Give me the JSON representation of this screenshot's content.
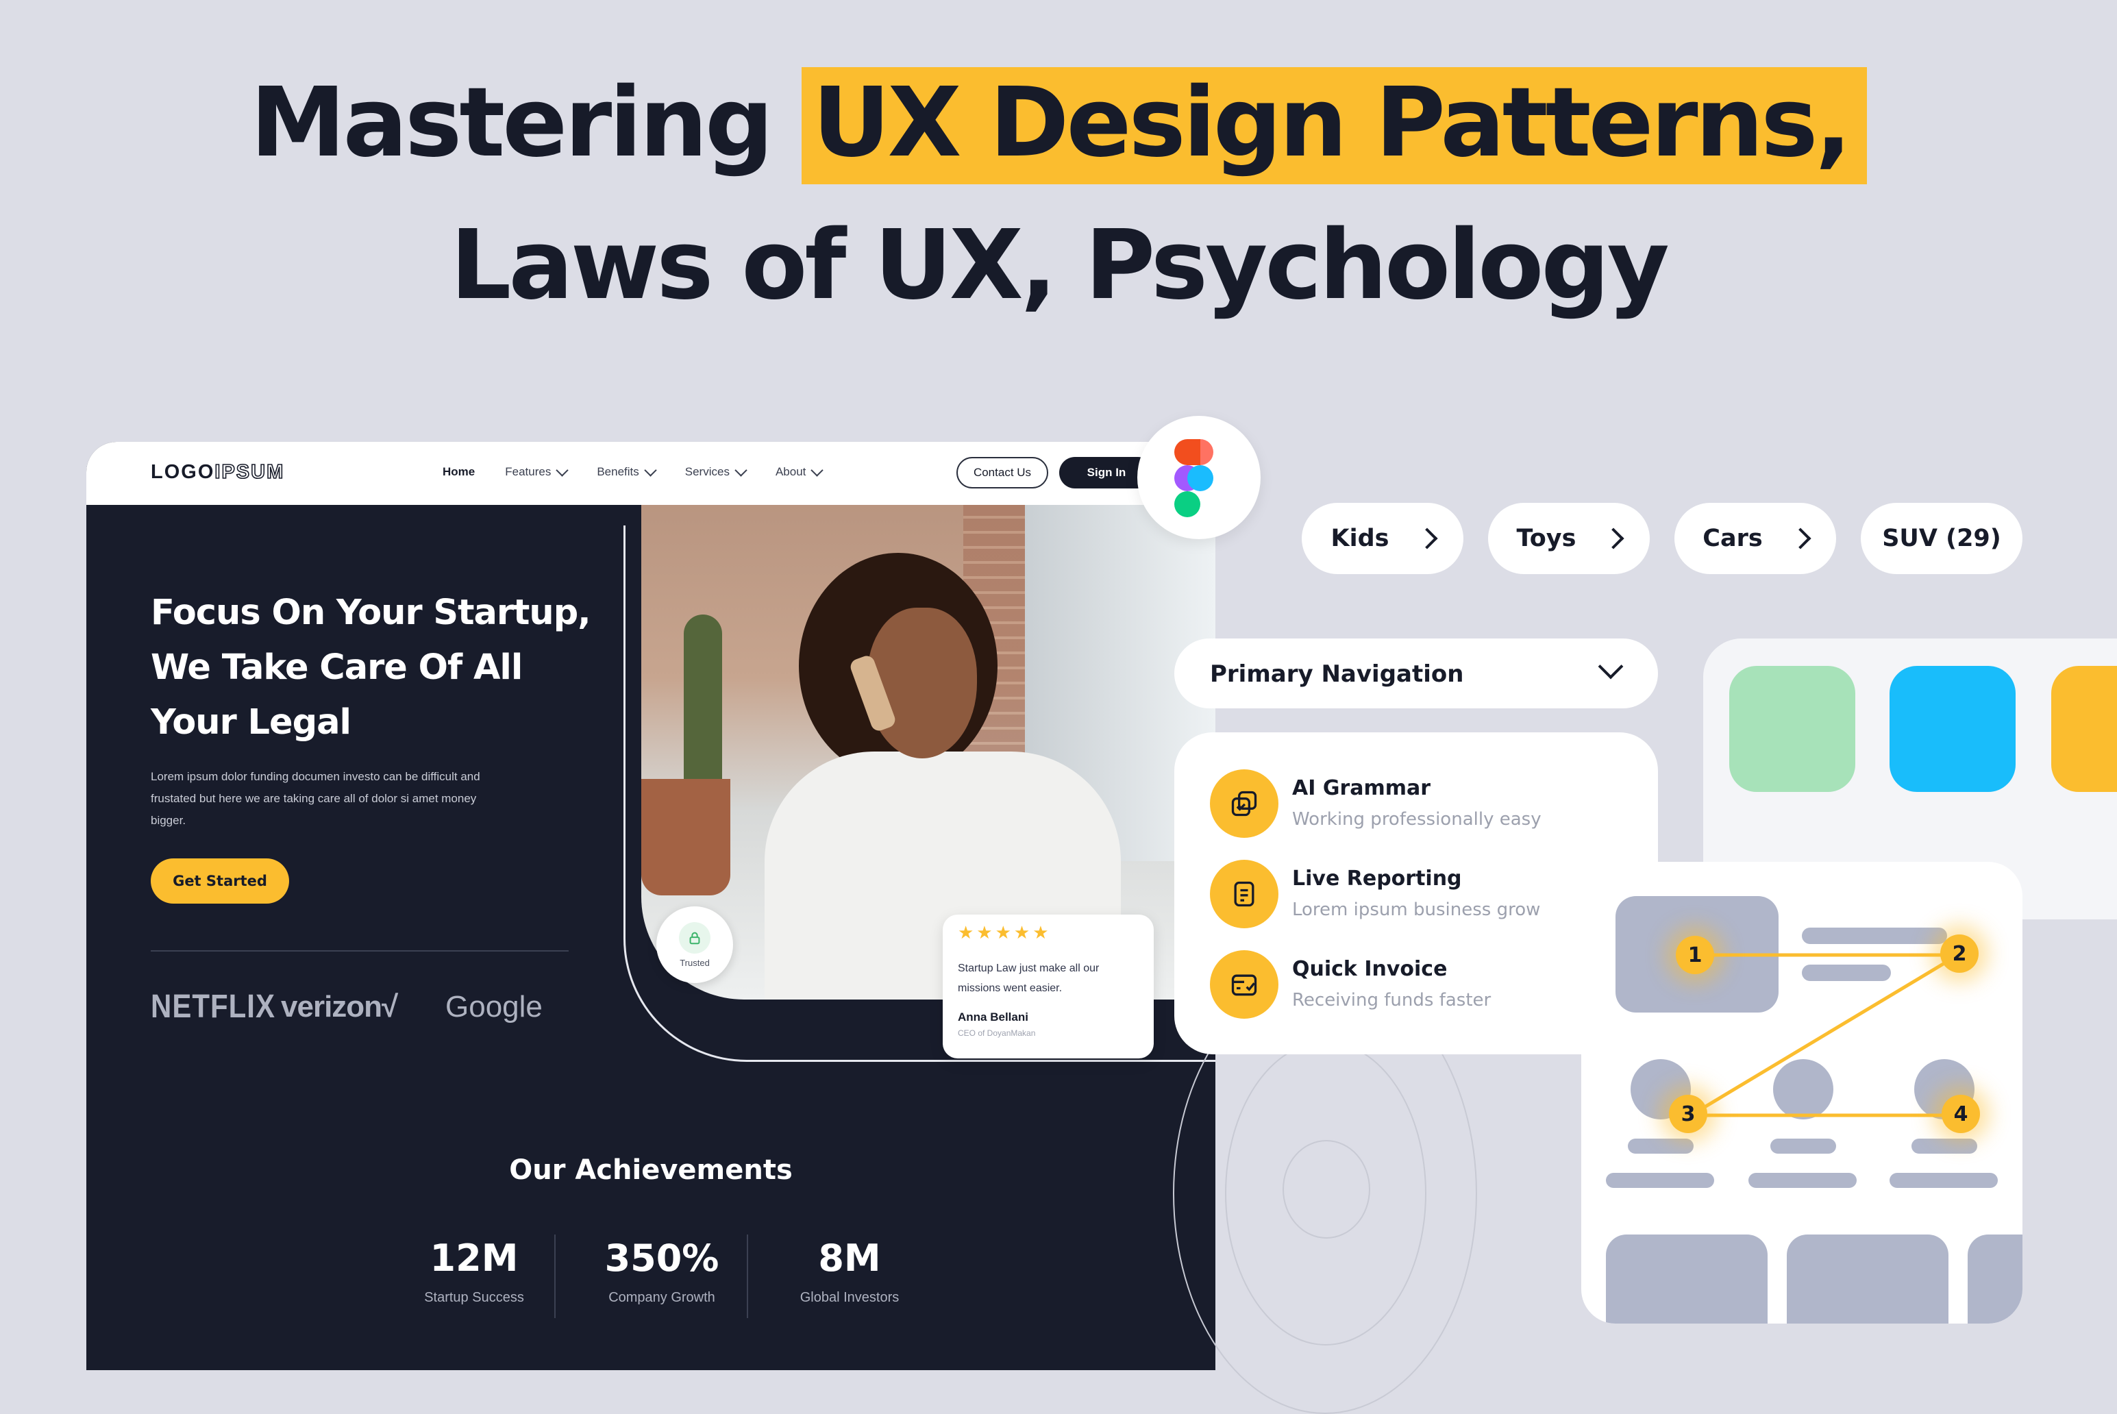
{
  "headline": {
    "line1_plain": "Mastering",
    "line1_highlight": "UX Design Patterns,",
    "line2": "Laws of UX, Psychology"
  },
  "landing": {
    "logo": {
      "part1": "LOGO",
      "part2": "IPSUM"
    },
    "nav": {
      "home": "Home",
      "features": "Features",
      "benefits": "Benefits",
      "services": "Services",
      "about": "About"
    },
    "contact_label": "Contact Us",
    "signin_label": "Sign In",
    "hero": {
      "title": "Focus On Your Startup, We Take Care Of All Your Legal",
      "description": "Lorem ipsum dolor funding documen investo can be difficult  and frustated but here we are taking care all of dolor si amet money bigger.",
      "cta": "Get Started"
    },
    "brands": [
      "NETFLIX",
      "verizon√",
      "Google"
    ],
    "trusted_label": "Trusted",
    "review": {
      "stars": "★★★★★",
      "rating": 5,
      "text": "Startup Law just make all our missions went easier.",
      "name": "Anna Bellani",
      "role": "CEO of DoyanMakan"
    },
    "achievements": {
      "title": "Our Achievements",
      "stats": [
        {
          "value": "12M",
          "label": "Startup Success"
        },
        {
          "value": "350%",
          "label": "Company Growth"
        },
        {
          "value": "8M",
          "label": "Global Investors"
        }
      ]
    }
  },
  "chips": [
    {
      "label": "Kids"
    },
    {
      "label": "Toys"
    },
    {
      "label": "Cars"
    },
    {
      "label": "SUV (29)"
    }
  ],
  "primary_nav": {
    "label": "Primary Navigation",
    "items": [
      {
        "title": "AI Grammar",
        "subtitle": "Working professionally easy",
        "icon": "copy-check-icon"
      },
      {
        "title": "Live Reporting",
        "subtitle": "Lorem ipsum business grow",
        "icon": "document-icon"
      },
      {
        "title": "Quick Invoice",
        "subtitle": "Receiving funds faster",
        "icon": "card-check-icon"
      }
    ]
  },
  "swatches": [
    "#a7e2b9",
    "#19bdfb",
    "#fbbd2f"
  ],
  "zigzag_steps": [
    "1",
    "2",
    "3",
    "4"
  ],
  "colors": {
    "accent": "#fbbd2f",
    "dark": "#181c2b",
    "background": "#dcdde6"
  }
}
